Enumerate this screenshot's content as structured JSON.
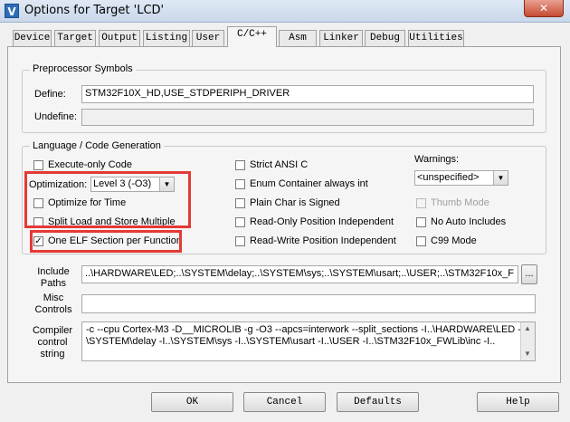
{
  "window": {
    "title": "Options for Target 'LCD'",
    "icon_glyph": "V",
    "close_glyph": "✕"
  },
  "tabs": [
    {
      "label": "Device"
    },
    {
      "label": "Target"
    },
    {
      "label": "Output"
    },
    {
      "label": "Listing"
    },
    {
      "label": "User"
    },
    {
      "label": "C/C++"
    },
    {
      "label": "Asm"
    },
    {
      "label": "Linker"
    },
    {
      "label": "Debug"
    },
    {
      "label": "Utilities"
    }
  ],
  "preprocessor": {
    "legend": "Preprocessor Symbols",
    "define_label": "Define:",
    "define_value": "STM32F10X_HD,USE_STDPERIPH_DRIVER",
    "undefine_label": "Undefine:",
    "undefine_value": ""
  },
  "language": {
    "legend": "Language / Code Generation",
    "execute_only": {
      "label": "Execute-only Code",
      "checked": false
    },
    "optimization_label": "Optimization:",
    "optimization_value": "Level 3 (-O3)",
    "optimize_time": {
      "label": "Optimize for Time",
      "checked": false
    },
    "split_load": {
      "label": "Split Load and Store Multiple",
      "checked": false
    },
    "one_elf": {
      "label": "One ELF Section per Function",
      "checked": true
    },
    "strict_ansi": {
      "label": "Strict ANSI C",
      "checked": false
    },
    "enum_container": {
      "label": "Enum Container always int",
      "checked": false
    },
    "plain_char": {
      "label": "Plain Char is Signed",
      "checked": false
    },
    "ro_pi": {
      "label": "Read-Only Position Independent",
      "checked": false
    },
    "rw_pi": {
      "label": "Read-Write Position Independent",
      "checked": false
    },
    "warnings_label": "Warnings:",
    "warnings_value": "<unspecified>",
    "thumb_mode": {
      "label": "Thumb Mode",
      "checked": false
    },
    "no_auto_includes": {
      "label": "No Auto Includes",
      "checked": false
    },
    "c99_mode": {
      "label": "C99 Mode",
      "checked": false
    }
  },
  "paths": {
    "include_label_1": "Include",
    "include_label_2": "Paths",
    "include_value": "..\\HARDWARE\\LED;..\\SYSTEM\\delay;..\\SYSTEM\\sys;..\\SYSTEM\\usart;..\\USER;..\\STM32F10x_F",
    "browse_label": "...",
    "misc_label_1": "Misc",
    "misc_label_2": "Controls",
    "misc_value": "",
    "compiler_label_1": "Compiler",
    "compiler_label_2": "control",
    "compiler_label_3": "string",
    "compiler_line_1": "-c --cpu Cortex-M3 -D__MICROLIB -g -O3 --apcs=interwork --split_sections -I..\\HARDWARE\\LED -I..",
    "compiler_line_2": "\\SYSTEM\\delay -I..\\SYSTEM\\sys -I..\\SYSTEM\\usart -I..\\USER -I..\\STM32F10x_FWLib\\inc -I.."
  },
  "buttons": {
    "ok": "OK",
    "cancel": "Cancel",
    "defaults": "Defaults",
    "help": "Help"
  },
  "colors": {
    "highlight": "#e53935",
    "active_tab": "#f5f5f5"
  }
}
